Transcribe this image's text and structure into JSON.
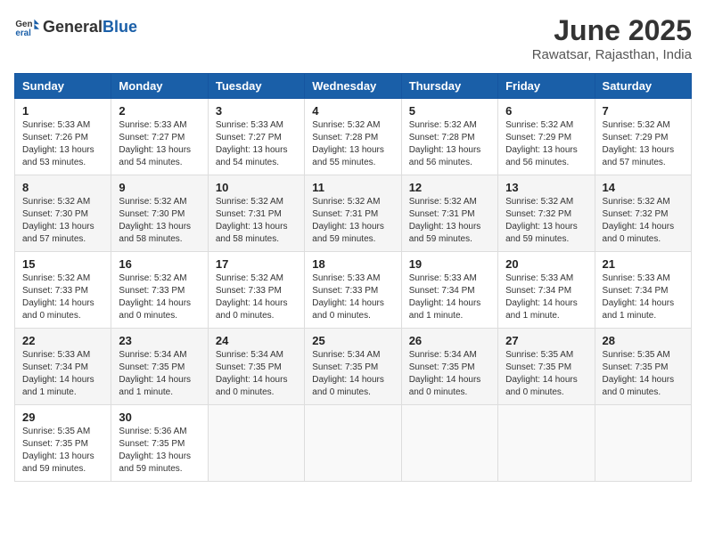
{
  "header": {
    "logo_general": "General",
    "logo_blue": "Blue",
    "month_title": "June 2025",
    "subtitle": "Rawatsar, Rajasthan, India"
  },
  "days_of_week": [
    "Sunday",
    "Monday",
    "Tuesday",
    "Wednesday",
    "Thursday",
    "Friday",
    "Saturday"
  ],
  "weeks": [
    [
      {
        "day": "1",
        "sunrise": "Sunrise: 5:33 AM",
        "sunset": "Sunset: 7:26 PM",
        "daylight": "Daylight: 13 hours and 53 minutes."
      },
      {
        "day": "2",
        "sunrise": "Sunrise: 5:33 AM",
        "sunset": "Sunset: 7:27 PM",
        "daylight": "Daylight: 13 hours and 54 minutes."
      },
      {
        "day": "3",
        "sunrise": "Sunrise: 5:33 AM",
        "sunset": "Sunset: 7:27 PM",
        "daylight": "Daylight: 13 hours and 54 minutes."
      },
      {
        "day": "4",
        "sunrise": "Sunrise: 5:32 AM",
        "sunset": "Sunset: 7:28 PM",
        "daylight": "Daylight: 13 hours and 55 minutes."
      },
      {
        "day": "5",
        "sunrise": "Sunrise: 5:32 AM",
        "sunset": "Sunset: 7:28 PM",
        "daylight": "Daylight: 13 hours and 56 minutes."
      },
      {
        "day": "6",
        "sunrise": "Sunrise: 5:32 AM",
        "sunset": "Sunset: 7:29 PM",
        "daylight": "Daylight: 13 hours and 56 minutes."
      },
      {
        "day": "7",
        "sunrise": "Sunrise: 5:32 AM",
        "sunset": "Sunset: 7:29 PM",
        "daylight": "Daylight: 13 hours and 57 minutes."
      }
    ],
    [
      {
        "day": "8",
        "sunrise": "Sunrise: 5:32 AM",
        "sunset": "Sunset: 7:30 PM",
        "daylight": "Daylight: 13 hours and 57 minutes."
      },
      {
        "day": "9",
        "sunrise": "Sunrise: 5:32 AM",
        "sunset": "Sunset: 7:30 PM",
        "daylight": "Daylight: 13 hours and 58 minutes."
      },
      {
        "day": "10",
        "sunrise": "Sunrise: 5:32 AM",
        "sunset": "Sunset: 7:31 PM",
        "daylight": "Daylight: 13 hours and 58 minutes."
      },
      {
        "day": "11",
        "sunrise": "Sunrise: 5:32 AM",
        "sunset": "Sunset: 7:31 PM",
        "daylight": "Daylight: 13 hours and 59 minutes."
      },
      {
        "day": "12",
        "sunrise": "Sunrise: 5:32 AM",
        "sunset": "Sunset: 7:31 PM",
        "daylight": "Daylight: 13 hours and 59 minutes."
      },
      {
        "day": "13",
        "sunrise": "Sunrise: 5:32 AM",
        "sunset": "Sunset: 7:32 PM",
        "daylight": "Daylight: 13 hours and 59 minutes."
      },
      {
        "day": "14",
        "sunrise": "Sunrise: 5:32 AM",
        "sunset": "Sunset: 7:32 PM",
        "daylight": "Daylight: 14 hours and 0 minutes."
      }
    ],
    [
      {
        "day": "15",
        "sunrise": "Sunrise: 5:32 AM",
        "sunset": "Sunset: 7:33 PM",
        "daylight": "Daylight: 14 hours and 0 minutes."
      },
      {
        "day": "16",
        "sunrise": "Sunrise: 5:32 AM",
        "sunset": "Sunset: 7:33 PM",
        "daylight": "Daylight: 14 hours and 0 minutes."
      },
      {
        "day": "17",
        "sunrise": "Sunrise: 5:32 AM",
        "sunset": "Sunset: 7:33 PM",
        "daylight": "Daylight: 14 hours and 0 minutes."
      },
      {
        "day": "18",
        "sunrise": "Sunrise: 5:33 AM",
        "sunset": "Sunset: 7:33 PM",
        "daylight": "Daylight: 14 hours and 0 minutes."
      },
      {
        "day": "19",
        "sunrise": "Sunrise: 5:33 AM",
        "sunset": "Sunset: 7:34 PM",
        "daylight": "Daylight: 14 hours and 1 minute."
      },
      {
        "day": "20",
        "sunrise": "Sunrise: 5:33 AM",
        "sunset": "Sunset: 7:34 PM",
        "daylight": "Daylight: 14 hours and 1 minute."
      },
      {
        "day": "21",
        "sunrise": "Sunrise: 5:33 AM",
        "sunset": "Sunset: 7:34 PM",
        "daylight": "Daylight: 14 hours and 1 minute."
      }
    ],
    [
      {
        "day": "22",
        "sunrise": "Sunrise: 5:33 AM",
        "sunset": "Sunset: 7:34 PM",
        "daylight": "Daylight: 14 hours and 1 minute."
      },
      {
        "day": "23",
        "sunrise": "Sunrise: 5:34 AM",
        "sunset": "Sunset: 7:35 PM",
        "daylight": "Daylight: 14 hours and 1 minute."
      },
      {
        "day": "24",
        "sunrise": "Sunrise: 5:34 AM",
        "sunset": "Sunset: 7:35 PM",
        "daylight": "Daylight: 14 hours and 0 minutes."
      },
      {
        "day": "25",
        "sunrise": "Sunrise: 5:34 AM",
        "sunset": "Sunset: 7:35 PM",
        "daylight": "Daylight: 14 hours and 0 minutes."
      },
      {
        "day": "26",
        "sunrise": "Sunrise: 5:34 AM",
        "sunset": "Sunset: 7:35 PM",
        "daylight": "Daylight: 14 hours and 0 minutes."
      },
      {
        "day": "27",
        "sunrise": "Sunrise: 5:35 AM",
        "sunset": "Sunset: 7:35 PM",
        "daylight": "Daylight: 14 hours and 0 minutes."
      },
      {
        "day": "28",
        "sunrise": "Sunrise: 5:35 AM",
        "sunset": "Sunset: 7:35 PM",
        "daylight": "Daylight: 14 hours and 0 minutes."
      }
    ],
    [
      {
        "day": "29",
        "sunrise": "Sunrise: 5:35 AM",
        "sunset": "Sunset: 7:35 PM",
        "daylight": "Daylight: 13 hours and 59 minutes."
      },
      {
        "day": "30",
        "sunrise": "Sunrise: 5:36 AM",
        "sunset": "Sunset: 7:35 PM",
        "daylight": "Daylight: 13 hours and 59 minutes."
      },
      null,
      null,
      null,
      null,
      null
    ]
  ]
}
